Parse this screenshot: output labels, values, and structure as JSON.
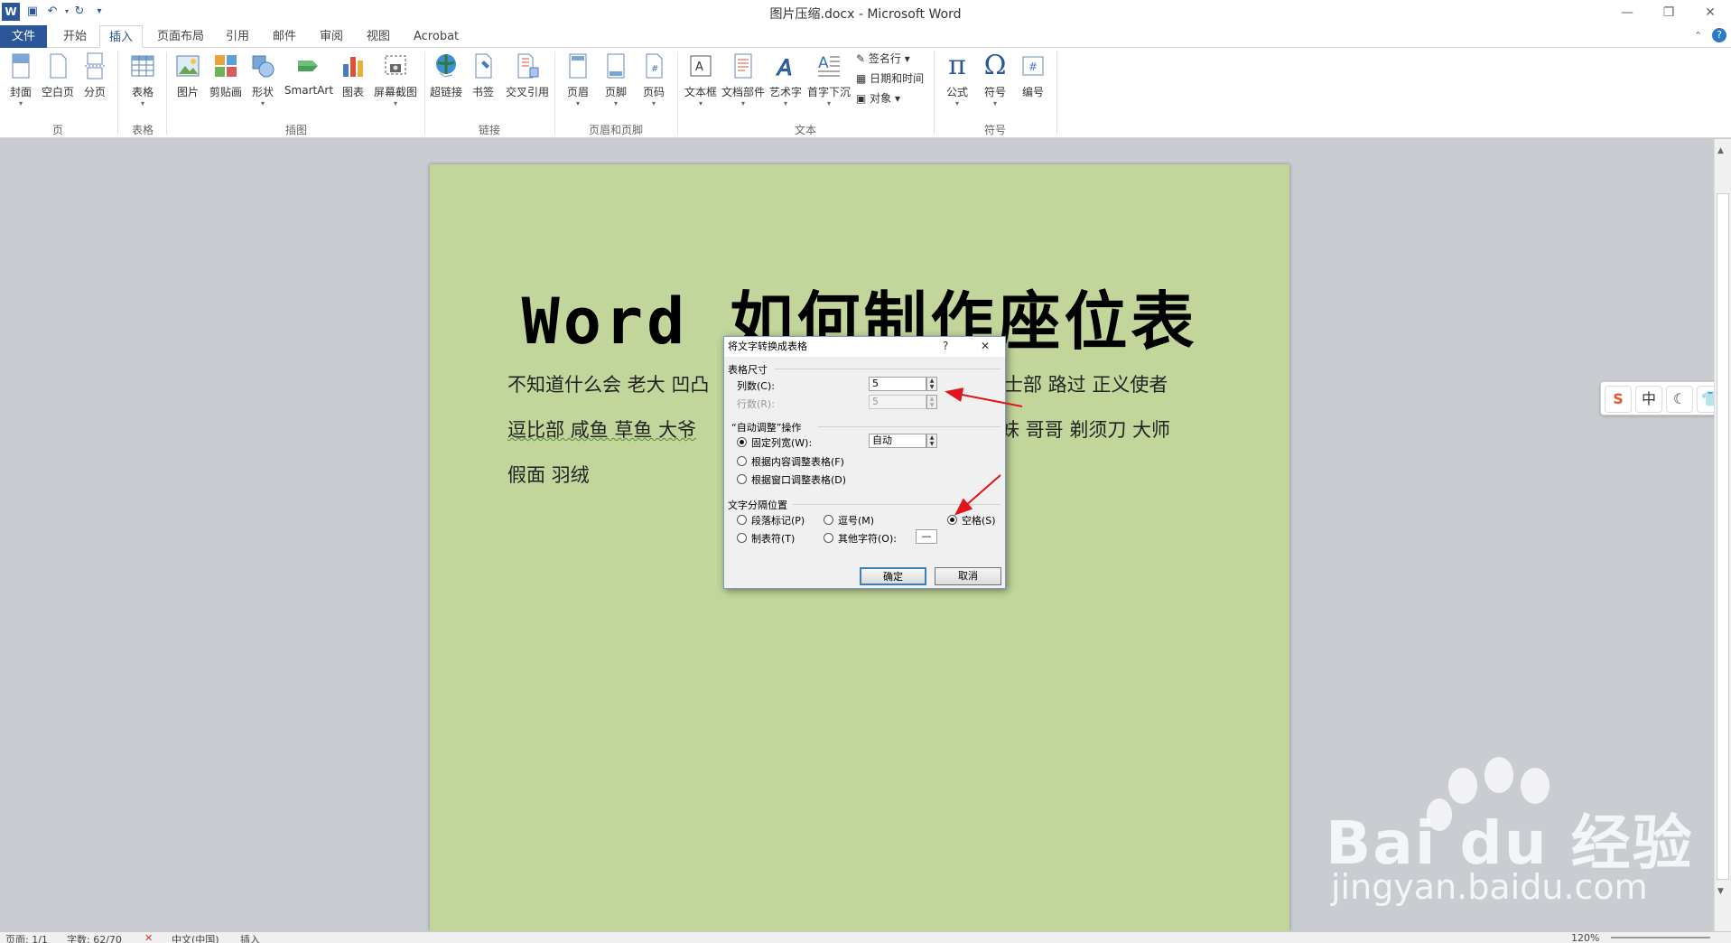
{
  "window": {
    "title": "图片压缩.docx - Microsoft Word"
  },
  "tabs": {
    "file": "文件",
    "items": [
      "开始",
      "插入",
      "页面布局",
      "引用",
      "邮件",
      "审阅",
      "视图",
      "Acrobat"
    ]
  },
  "ribbon": {
    "page": {
      "cover": "封面",
      "blank": "空白页",
      "break": "分页",
      "group": "页"
    },
    "table": {
      "table": "表格",
      "group": "表格"
    },
    "illustrations": {
      "picture": "图片",
      "clipart": "剪贴画",
      "shapes": "形状",
      "smartart": "SmartArt",
      "chart": "图表",
      "screenshot": "屏幕截图",
      "group": "插图"
    },
    "links": {
      "hyperlink": "超链接",
      "bookmark": "书签",
      "crossref": "交叉引用",
      "group": "链接"
    },
    "headerfooter": {
      "header": "页眉",
      "footer": "页脚",
      "pagenum": "页码",
      "group": "页眉和页脚"
    },
    "text": {
      "textbox": "文本框",
      "quickparts": "文档部件",
      "wordart": "艺术字",
      "dropcap": "首字下沉",
      "signature": "签名行",
      "datetime": "日期和时间",
      "object": "对象",
      "group": "文本"
    },
    "symbols": {
      "equation": "公式",
      "symbol": "符号",
      "number": "编号",
      "group": "符号"
    }
  },
  "document": {
    "title": "Word 如何制作座位表",
    "line1_left": "不知道什么会  老大  凹凸",
    "line1_right": "士部  路过  正义使者",
    "line2_left": "逗比部  咸鱼  草鱼  大爷",
    "line2_right": "妹  哥哥  剃须刀  大师",
    "line3": "假面  羽绒"
  },
  "dialog": {
    "title": "将文字转换成表格",
    "help": "?",
    "close": "✕",
    "section_size": "表格尺寸",
    "cols_label": "列数(C):",
    "cols_value": "5",
    "rows_label": "行数(R):",
    "rows_value": "5",
    "section_autofit": "“自动调整”操作",
    "fixed_width": "固定列宽(W):",
    "fixed_width_value": "自动",
    "autofit_content": "根据内容调整表格(F)",
    "autofit_window": "根据窗口调整表格(D)",
    "section_separator": "文字分隔位置",
    "sep_paragraph": "段落标记(P)",
    "sep_comma": "逗号(M)",
    "sep_space": "空格(S)",
    "sep_tab": "制表符(T)",
    "sep_other": "其他字符(O):",
    "sep_other_value": "—",
    "ok": "确定",
    "cancel": "取消"
  },
  "ime": {
    "mode": "中"
  },
  "statusbar": {
    "page": "页面: 1/1",
    "words": "字数: 62/70",
    "lang": "中文(中国)",
    "insert": "插入",
    "zoom": "120%"
  },
  "watermark": {
    "brand": "Bai du 经验",
    "url": "jingyan.baidu.com"
  },
  "colors": {
    "accent": "#2b579a",
    "page": "#c2d69b",
    "arrow": "#e0151b"
  }
}
